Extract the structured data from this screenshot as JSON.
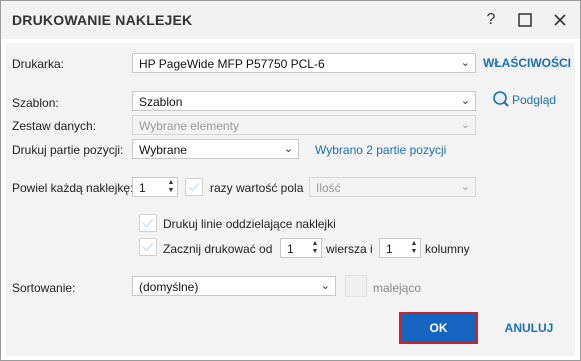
{
  "title": "DRUKOWANIE NAKLEJEK",
  "titlebar": {
    "help": "?",
    "maximize": "☐",
    "close": "✕"
  },
  "printer": {
    "label": "Drukarka:",
    "value": "HP PageWide MFP P57750 PCL-6",
    "properties_link": "WŁAŚCIWOŚCI"
  },
  "template": {
    "label": "Szablon:",
    "value": "Szablon",
    "preview_link": "Podgląd"
  },
  "dataset": {
    "label": "Zestaw danych:",
    "value": "Wybrane elementy"
  },
  "batches": {
    "label": "Drukuj partie pozycji:",
    "value": "Wybrane",
    "info_link": "Wybrano 2 partie pozycji"
  },
  "repeat": {
    "label": "Powiel każdą naklejkę:",
    "count": "1",
    "times_label": "razy wartość pola",
    "field_value": "Ilość"
  },
  "separator_lines": {
    "label": "Drukuj linie oddzielające naklejki"
  },
  "start_print": {
    "label": "Zacznij drukować od",
    "row": "1",
    "row_label": "wiersza i",
    "col": "1",
    "col_label": "kolumny"
  },
  "sorting": {
    "label": "Sortowanie:",
    "value": "(domyślne)",
    "desc_label": "malejąco"
  },
  "buttons": {
    "ok": "OK",
    "cancel": "ANULUJ"
  },
  "colors": {
    "accent": "#1565c0",
    "link": "#1a6fb5",
    "highlight_border": "#d0202a"
  }
}
